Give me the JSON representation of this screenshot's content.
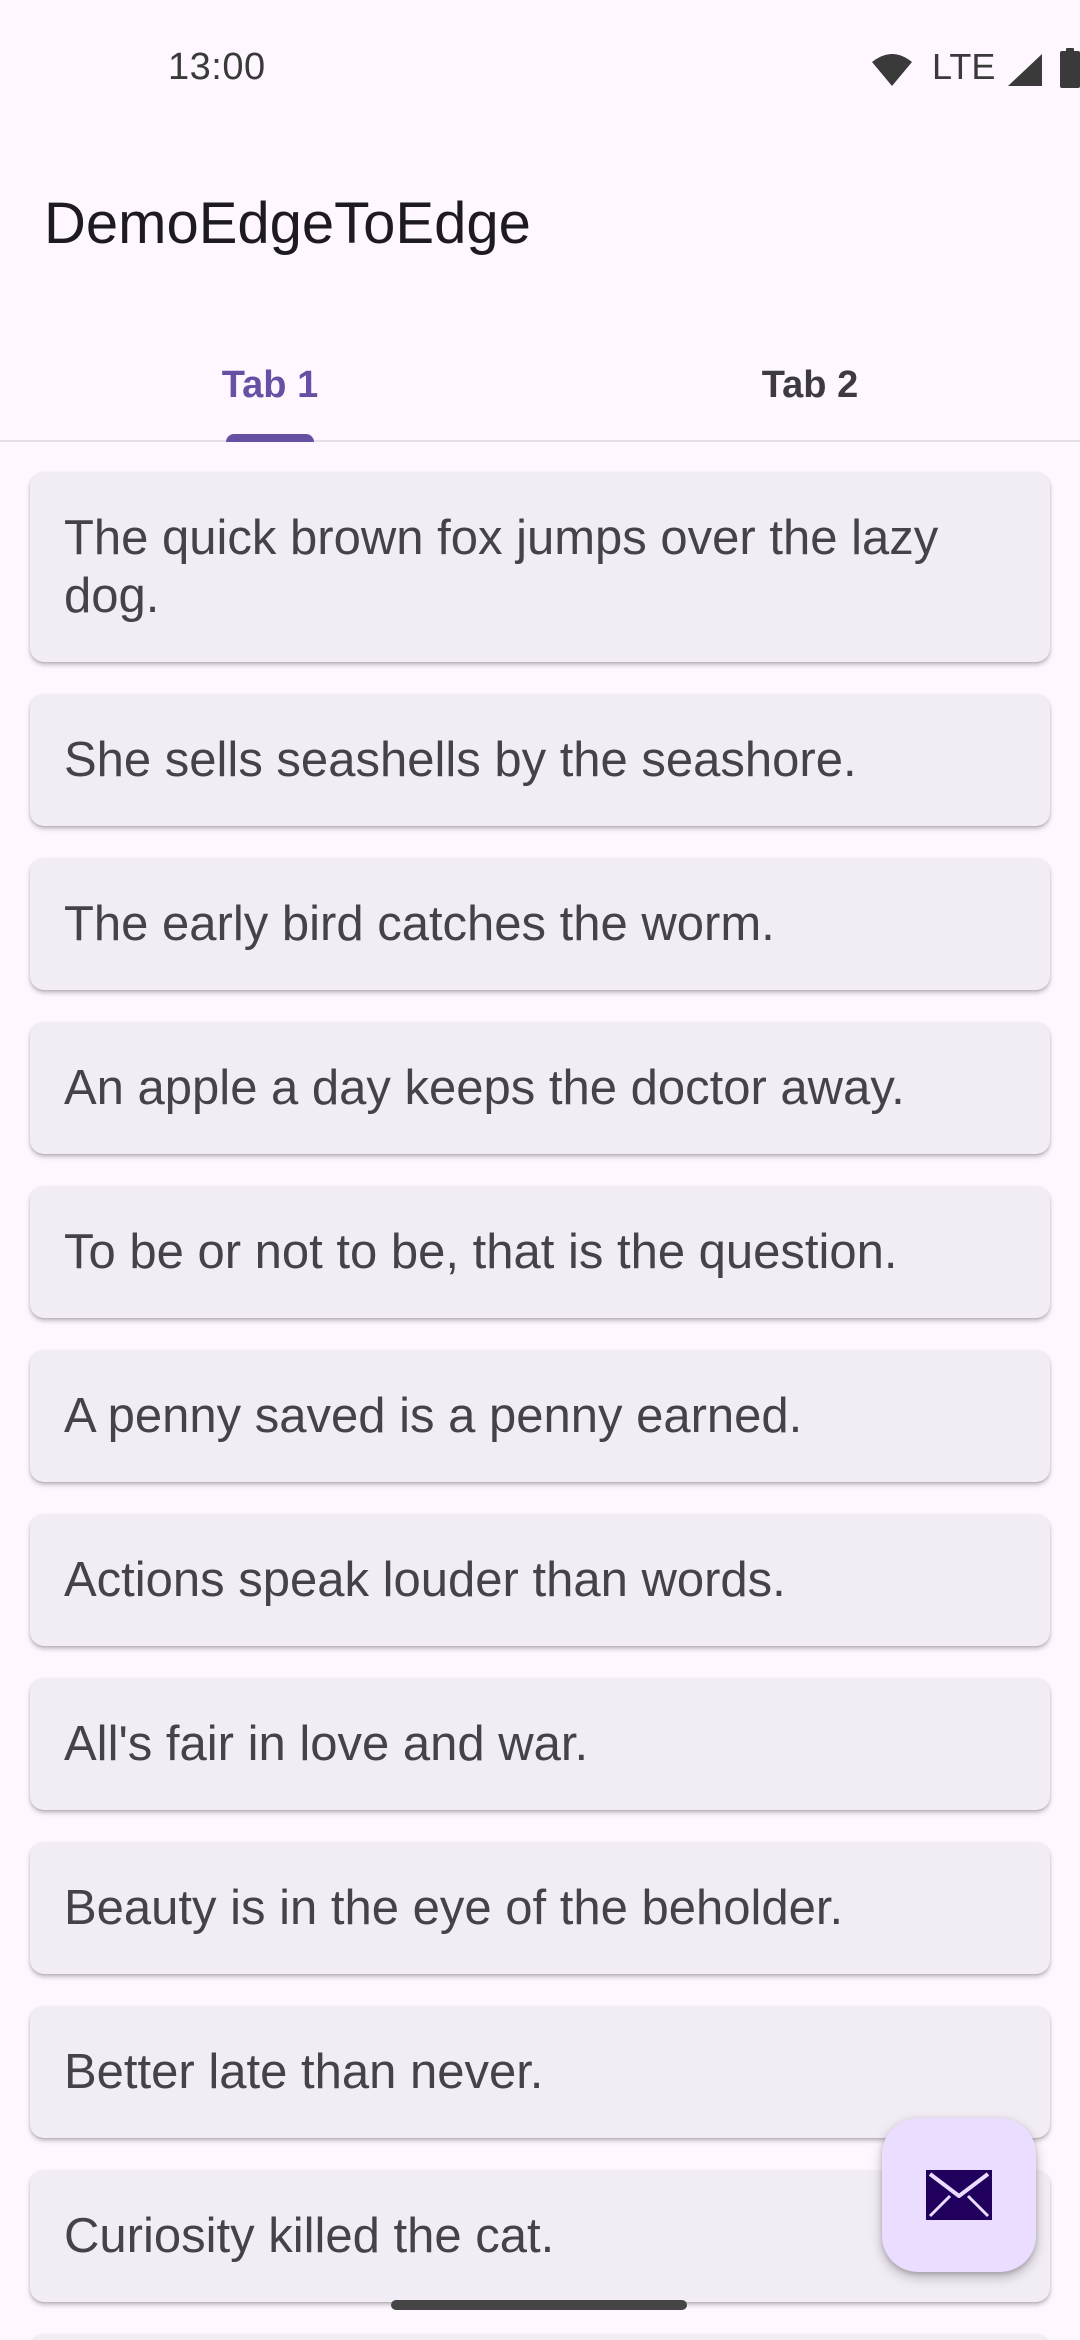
{
  "status_bar": {
    "time": "13:00",
    "network_label": "LTE",
    "icons": [
      "wifi-icon",
      "signal-icon",
      "battery-icon"
    ]
  },
  "app": {
    "title": "DemoEdgeToEdge"
  },
  "tabs": [
    {
      "label": "Tab 1",
      "selected": true
    },
    {
      "label": "Tab 2",
      "selected": false
    }
  ],
  "list_items": [
    "The quick brown fox jumps over the lazy dog.",
    "She sells seashells by the seashore.",
    "The early bird catches the worm.",
    "An apple a day keeps the doctor away.",
    "To be or not to be, that is the question.",
    "A penny saved is a penny earned.",
    "Actions speak louder than words.",
    "All's fair in love and war.",
    "Beauty is in the eye of the beholder.",
    "Better late than never.",
    "Curiosity killed the cat."
  ],
  "fab": {
    "icon": "mail-icon"
  },
  "colors": {
    "accent": "#6750a4",
    "background": "#fef7ff",
    "card": "#f2edf5",
    "fab": "#eaddff",
    "fab_icon": "#21005d"
  }
}
